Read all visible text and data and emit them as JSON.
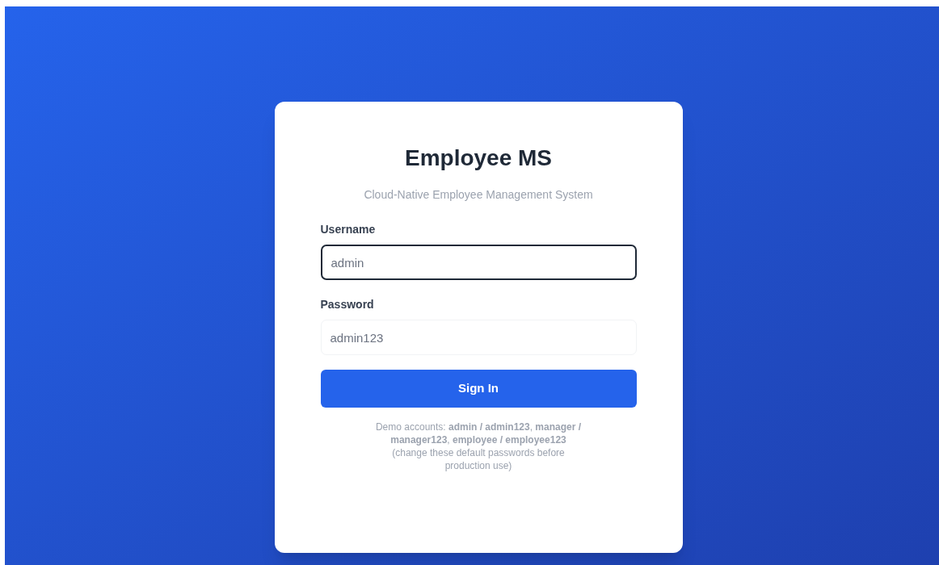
{
  "title": "Employee MS",
  "subtitle": "Cloud-Native Employee Management System",
  "fields": [
    {
      "label": "Username",
      "placeholder": "admin",
      "focused": true
    },
    {
      "label": "Password",
      "placeholder": "admin123",
      "focused": false
    }
  ],
  "submit": "Sign In",
  "demo_note": "Demo accounts: **admin / admin123**, **manager / manager123**, **employee / employee123**",
  "disclaimer": "(change these default passwords before production use)"
}
